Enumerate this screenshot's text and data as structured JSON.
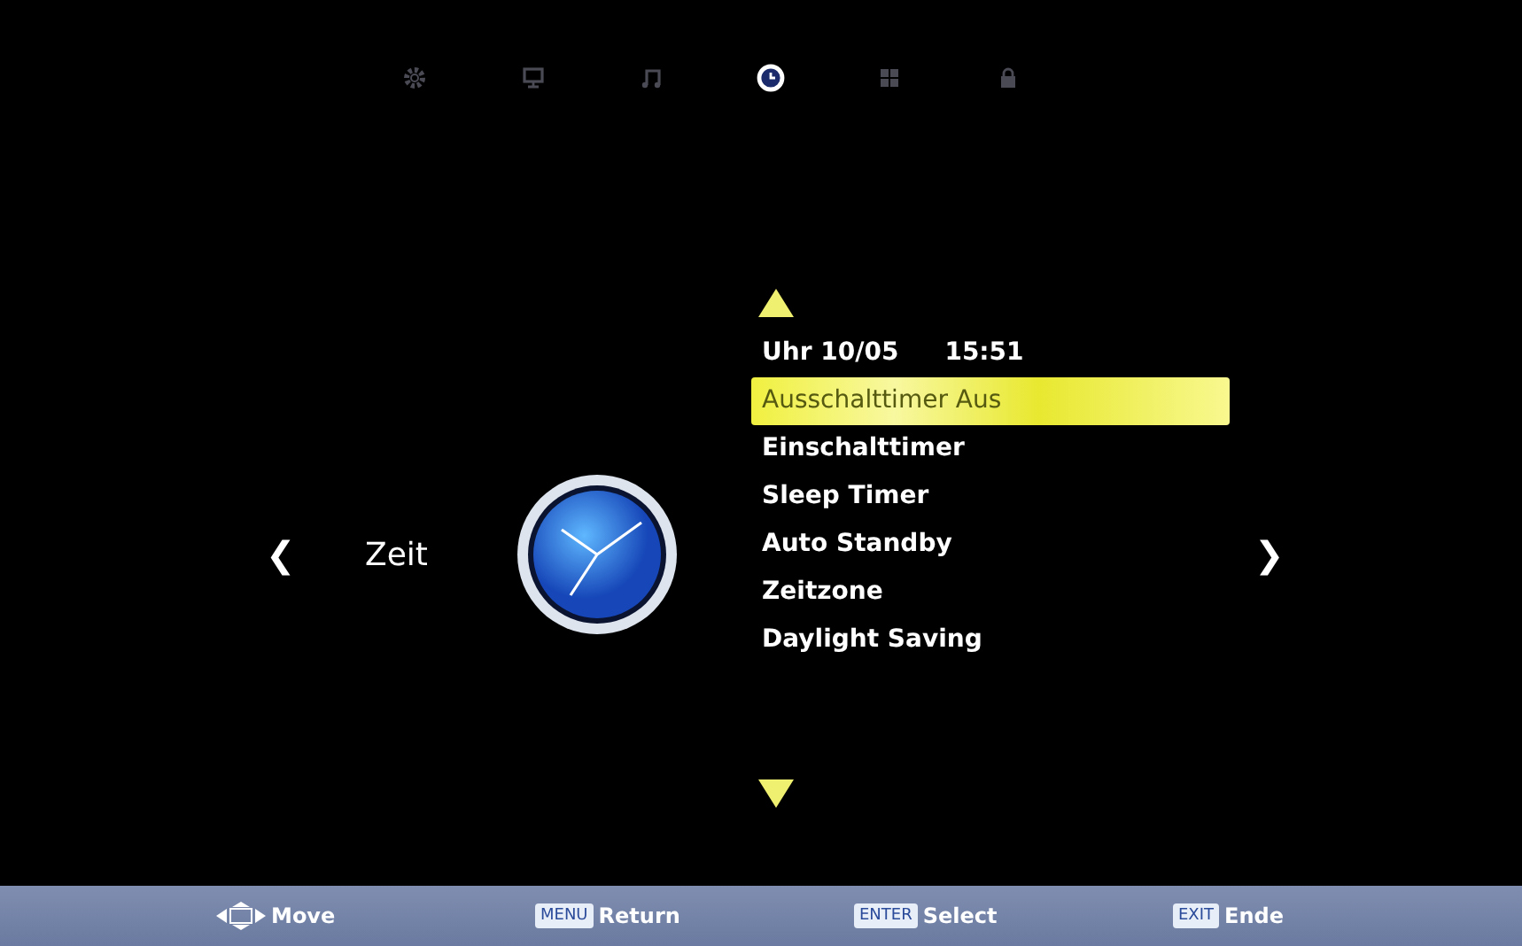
{
  "category_tabs": [
    {
      "kind": "gear",
      "selected": false
    },
    {
      "kind": "monitor",
      "selected": false
    },
    {
      "kind": "music",
      "selected": false
    },
    {
      "kind": "clock",
      "selected": true
    },
    {
      "kind": "grid",
      "selected": false
    },
    {
      "kind": "lock",
      "selected": false
    }
  ],
  "prev_arrow": "❮",
  "category": "Zeit",
  "next_arrow": "❯",
  "clock_line": {
    "label": "Uhr 10/05",
    "time": "15:51"
  },
  "menu_items": [
    {
      "label": "Ausschalttimer Aus",
      "selected": true
    },
    {
      "label": "Einschalttimer",
      "selected": false
    },
    {
      "label": "Sleep Timer",
      "selected": false
    },
    {
      "label": "Auto Standby",
      "selected": false
    },
    {
      "label": "Zeitzone",
      "selected": false
    },
    {
      "label": "Daylight Saving",
      "selected": false
    }
  ],
  "footer": [
    {
      "kind": "arrows",
      "text": "Move"
    },
    {
      "kind": "key",
      "key": "MENU",
      "text": "Return"
    },
    {
      "kind": "key",
      "key": "ENTER",
      "text": "Select"
    },
    {
      "kind": "key",
      "key": "EXIT",
      "text": "Ende"
    }
  ]
}
